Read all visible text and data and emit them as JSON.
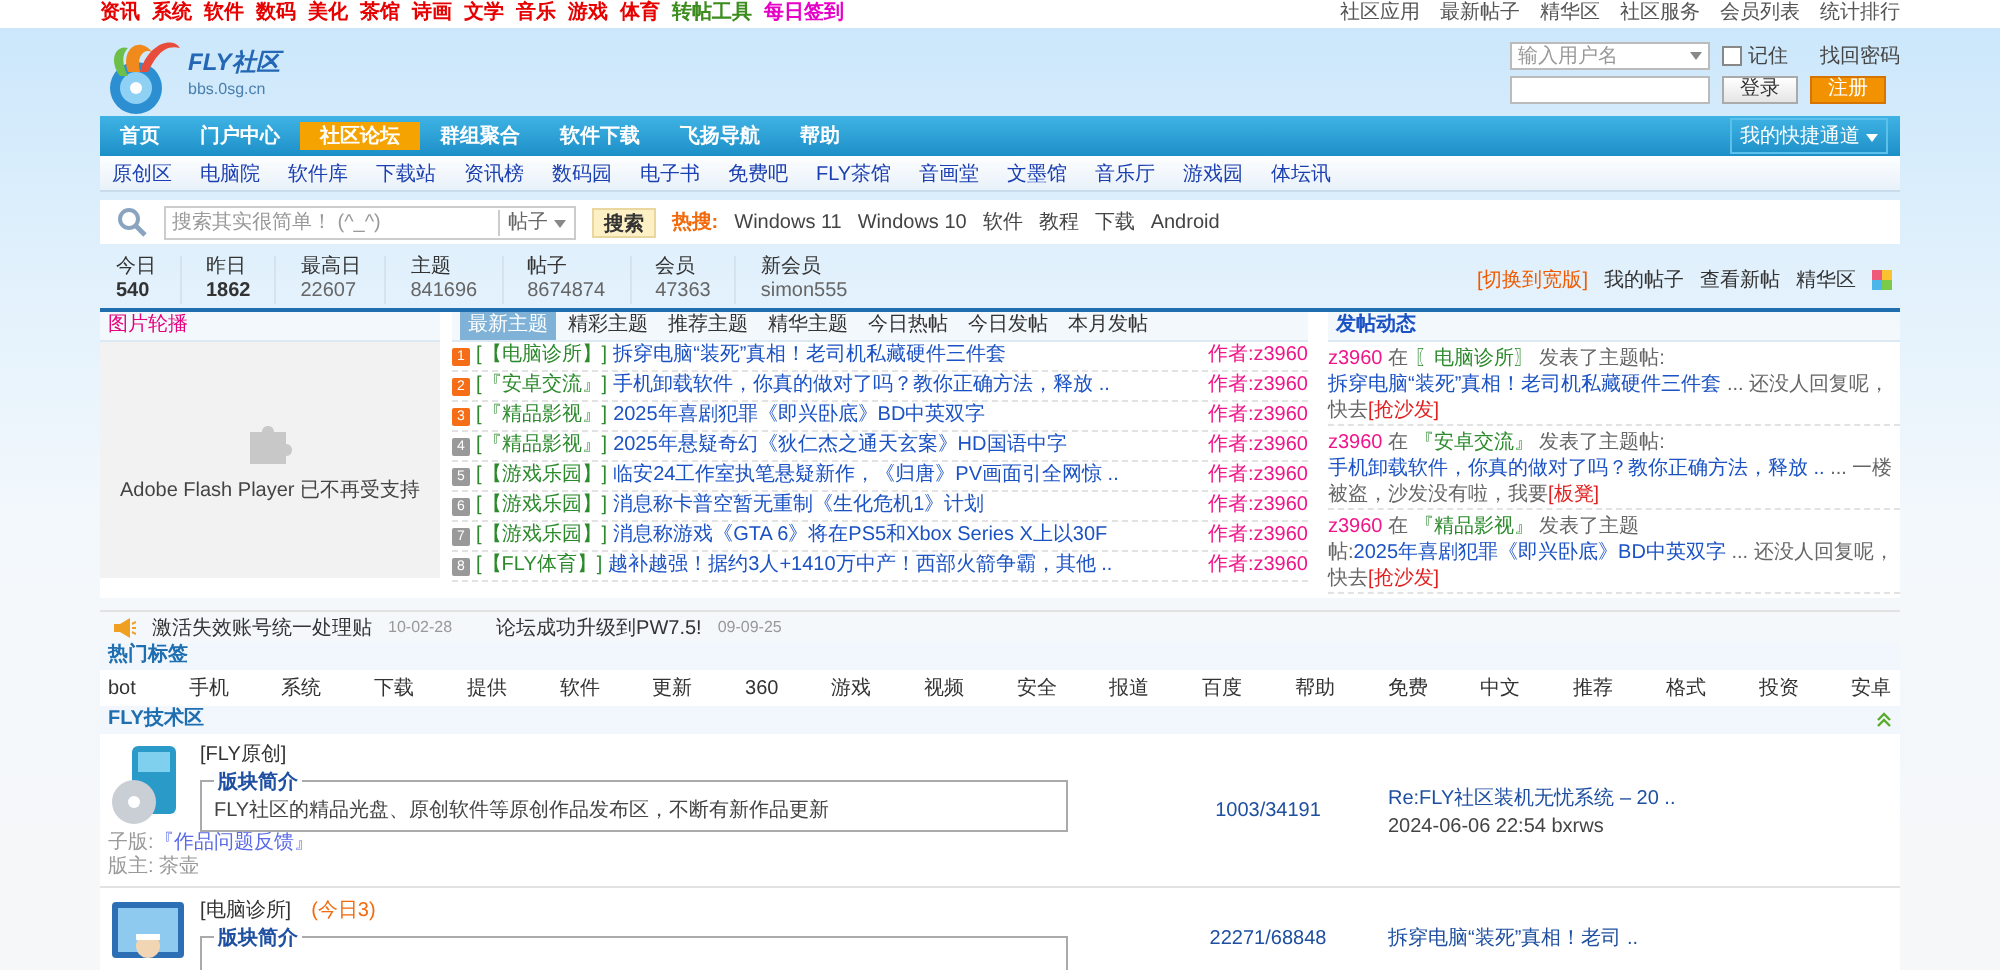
{
  "top_bar": {
    "links": [
      {
        "label": "资讯",
        "color": "#e60000"
      },
      {
        "label": "系统",
        "color": "#e60000"
      },
      {
        "label": "软件",
        "color": "#e60000"
      },
      {
        "label": "数码",
        "color": "#e60000"
      },
      {
        "label": "美化",
        "color": "#e60000"
      },
      {
        "label": "茶馆",
        "color": "#e60000"
      },
      {
        "label": "诗画",
        "color": "#e60000"
      },
      {
        "label": "文学",
        "color": "#e60000"
      },
      {
        "label": "音乐",
        "color": "#e60000"
      },
      {
        "label": "游戏",
        "color": "#e60000"
      },
      {
        "label": "体育",
        "color": "#e60000"
      },
      {
        "label": "转帖工具",
        "color": "#3c8c1e"
      },
      {
        "label": "每日签到",
        "color": "#e600c8"
      }
    ],
    "right_links": [
      "社区应用",
      "最新帖子",
      "精华区",
      "社区服务",
      "会员列表",
      "统计排行"
    ]
  },
  "logo": {
    "name": "FLY社区",
    "url": "bbs.0sg.cn"
  },
  "login": {
    "username_placeholder": "输入用户名",
    "remember": {
      "label": "记住",
      "checked": false
    },
    "forgot": "找回密码",
    "login_button": "登录",
    "register_button": "注册"
  },
  "main_nav": {
    "items": [
      {
        "label": "首页",
        "selected": false
      },
      {
        "label": "门户中心",
        "selected": false
      },
      {
        "label": "社区论坛",
        "selected": true
      },
      {
        "label": "群组聚合",
        "selected": false
      },
      {
        "label": "软件下载",
        "selected": false
      },
      {
        "label": "飞扬导航",
        "selected": false
      },
      {
        "label": "帮助",
        "selected": false
      }
    ],
    "quick": "我的快捷通道"
  },
  "sub_nav": [
    "原创区",
    "电脑院",
    "软件库",
    "下载站",
    "资讯榜",
    "数码园",
    "电子书",
    "免费吧",
    "FLY茶馆",
    "音画堂",
    "文墨馆",
    "音乐厅",
    "游戏园",
    "体坛讯"
  ],
  "search": {
    "placeholder": "搜索其实很简单！ (^_^)",
    "scope": "帖子",
    "button": "搜索",
    "hot_label": "热搜:",
    "hot_terms": [
      "Windows 11",
      "Windows 10",
      "软件",
      "教程",
      "下载",
      "Android"
    ]
  },
  "stats": [
    {
      "label": "今日",
      "value": "540"
    },
    {
      "label": "昨日",
      "value": "1862"
    },
    {
      "label": "最高日",
      "value": "22607"
    },
    {
      "label": "主题",
      "value": "841696"
    },
    {
      "label": "帖子",
      "value": "8674874"
    },
    {
      "label": "会员",
      "value": "47363"
    },
    {
      "label": "新会员",
      "value": "simon555"
    }
  ],
  "stats_links": {
    "switch": "[切换到宽版]",
    "links": [
      "我的帖子",
      "查看新帖",
      "精华区"
    ]
  },
  "slideshow": {
    "title": "图片轮播",
    "message": "Adobe Flash Player 已不再受支持"
  },
  "topic_tabs": [
    {
      "label": "最新主题",
      "selected": true
    },
    {
      "label": "精彩主题",
      "selected": false
    },
    {
      "label": "推荐主题",
      "selected": false
    },
    {
      "label": "精华主题",
      "selected": false
    },
    {
      "label": "今日热帖",
      "selected": false
    },
    {
      "label": "今日发帖",
      "selected": false
    },
    {
      "label": "本月发帖",
      "selected": false
    }
  ],
  "topics": [
    {
      "rank": "1",
      "hot": true,
      "forum": "[【电脑诊所】]",
      "title": "拆穿电脑“装死”真相！老司机私藏硬件三件套",
      "author": "作者:z3960"
    },
    {
      "rank": "2",
      "hot": true,
      "forum": "[『安卓交流』]",
      "title": "手机卸载软件，你真的做对了吗？教你正确方法，释放 ..",
      "author": "作者:z3960"
    },
    {
      "rank": "3",
      "hot": true,
      "forum": "[『精品影视』]",
      "title": "2025年喜剧犯罪《即兴卧底》BD中英双字",
      "author": "作者:z3960"
    },
    {
      "rank": "4",
      "hot": false,
      "forum": "[『精品影视』]",
      "title": "2025年悬疑奇幻《狄仁杰之通天玄案》HD国语中字",
      "author": "作者:z3960"
    },
    {
      "rank": "5",
      "hot": false,
      "forum": "[【游戏乐园】]",
      "title": "临安24工作室执笔悬疑新作，《归唐》PV画面引全网惊 ..",
      "author": "作者:z3960"
    },
    {
      "rank": "6",
      "hot": false,
      "forum": "[【游戏乐园】]",
      "title": "消息称卡普空暂无重制《生化危机1》计划",
      "author": "作者:z3960"
    },
    {
      "rank": "7",
      "hot": false,
      "forum": "[【游戏乐园】]",
      "title": "消息称游戏《GTA 6》将在PS5和Xbox Series X上以30F",
      "author": "作者:z3960"
    },
    {
      "rank": "8",
      "hot": false,
      "forum": "[【FLY体育】]",
      "title": "越补越强！据约3人+1410万中产！西部火箭争霸，其他 ..",
      "author": "作者:z3960"
    }
  ],
  "activity": {
    "title": "发帖动态",
    "entries": [
      {
        "user": "z3960",
        "verb": " 在 ",
        "forum": "〖电脑诊所〗",
        "action": " 发表了主题帖:",
        "topic": "拆穿电脑“装死”真相！老司机私藏硬件三件套",
        "tail": " ... 还没人回复呢，快去",
        "reply": "[抢沙发]"
      },
      {
        "user": "z3960",
        "verb": " 在 ",
        "forum": "『安卓交流』",
        "action": " 发表了主题帖:",
        "topic": "手机卸载软件，你真的做对了吗？教你正确方法，释放 ..",
        "tail": " ... 一楼被盗，沙发没有啦，我要",
        "reply": "[板凳]"
      },
      {
        "user": "z3960",
        "verb": " 在 ",
        "forum": "『精品影视』",
        "action": " 发表了主题帖:",
        "topic": "2025年喜剧犯罪《即兴卧底》BD中英双字",
        "tail": " ... 还没人回复呢，快去",
        "reply": "[抢沙发]"
      }
    ]
  },
  "notices": [
    {
      "text": "激活失效账号统一处理贴",
      "date": "10-02-28"
    },
    {
      "text": "论坛成功升级到PW7.5!",
      "date": "09-09-25"
    }
  ],
  "hot_tags": {
    "title": "热门标签",
    "tags": [
      "bot",
      "手机",
      "系统",
      "下载",
      "提供",
      "软件",
      "更新",
      "360",
      "游戏",
      "视频",
      "安全",
      "报道",
      "百度",
      "帮助",
      "免费",
      "中文",
      "推荐",
      "格式",
      "投资",
      "安卓"
    ]
  },
  "section": {
    "title": "FLY技术区",
    "forums": [
      {
        "kind": "disc",
        "name": "[FLY原创]",
        "intro_label": "版块简介",
        "intro": "FLY社区的精品光盘、原创软件等原创作品发布区，不断有新作品更新",
        "sub_label": "子版:",
        "sub_forum": "『作品问题反馈』",
        "moderator": "版主: 茶壶",
        "counts": "1003/34191",
        "last_title": "Re:FLY社区装机无忧系统 – 20 ..",
        "last_meta": "2024-06-06 22:54 bxrws"
      },
      {
        "kind": "monitor",
        "name": "[电脑诊所]",
        "today": "(今日3)",
        "intro_label": "版块简介",
        "counts": "22271/68848",
        "last_title": "拆穿电脑“装死”真相！老司 .."
      }
    ]
  }
}
